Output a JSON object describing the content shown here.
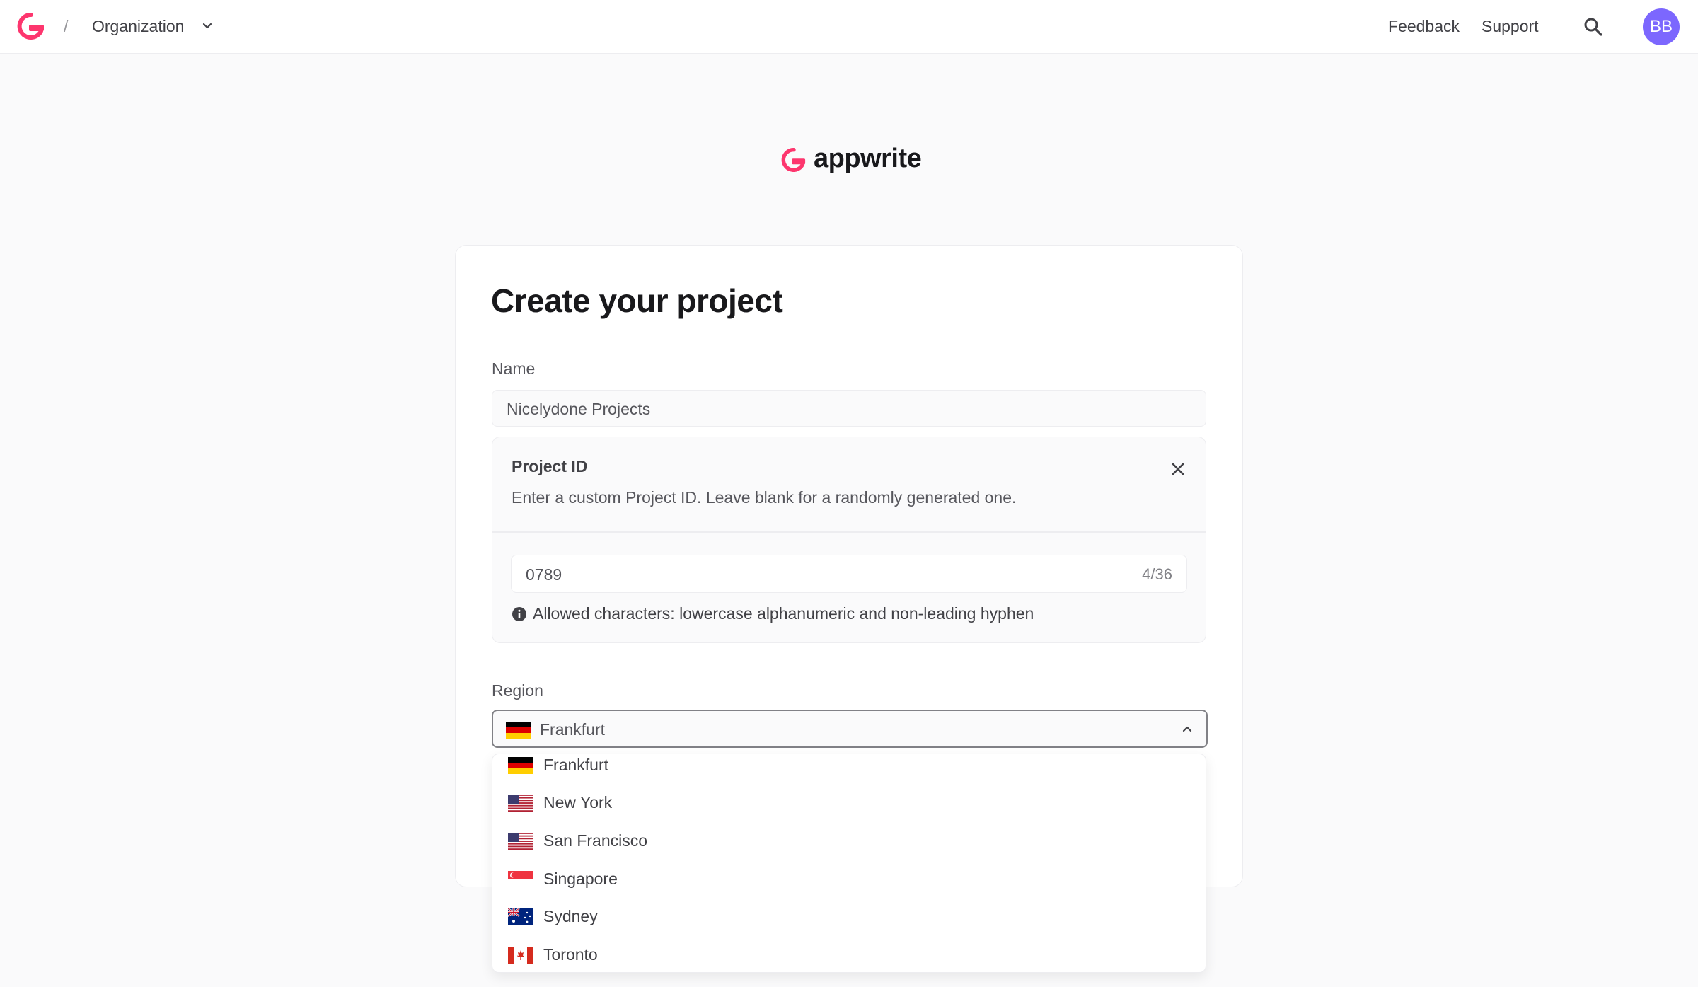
{
  "header": {
    "separator": "/",
    "organization": "Organization",
    "links": [
      "Feedback",
      "Support"
    ],
    "avatar_initials": "BB",
    "icons": [
      "appwrite-logo-icon",
      "chevron-down-icon",
      "search-icon"
    ]
  },
  "brand": {
    "name": "appwrite",
    "accent_color": "#fd366e"
  },
  "form": {
    "title": "Create your project",
    "name_label": "Name",
    "name_value": "Nicelydone Projects",
    "project_id": {
      "title": "Project ID",
      "description": "Enter a custom Project ID. Leave blank for a randomly generated one.",
      "value": "0789",
      "counter": "4/36",
      "help": "Allowed characters: lowercase alphanumeric and non-leading hyphen"
    },
    "region_label": "Region",
    "region_selected": "Frankfurt",
    "region_selected_flag": "germany-flag-icon",
    "region_options": [
      {
        "label": "Frankfurt",
        "flag": "germany-flag-icon"
      },
      {
        "label": "New York",
        "flag": "usa-flag-icon"
      },
      {
        "label": "San Francisco",
        "flag": "usa-flag-icon"
      },
      {
        "label": "Singapore",
        "flag": "singapore-flag-icon"
      },
      {
        "label": "Sydney",
        "flag": "australia-flag-icon"
      },
      {
        "label": "Toronto",
        "flag": "canada-flag-icon"
      }
    ]
  },
  "colors": {
    "avatar": "#7c67fe",
    "text": "#414146",
    "border": "#ededf0",
    "background": "#fafafb"
  }
}
